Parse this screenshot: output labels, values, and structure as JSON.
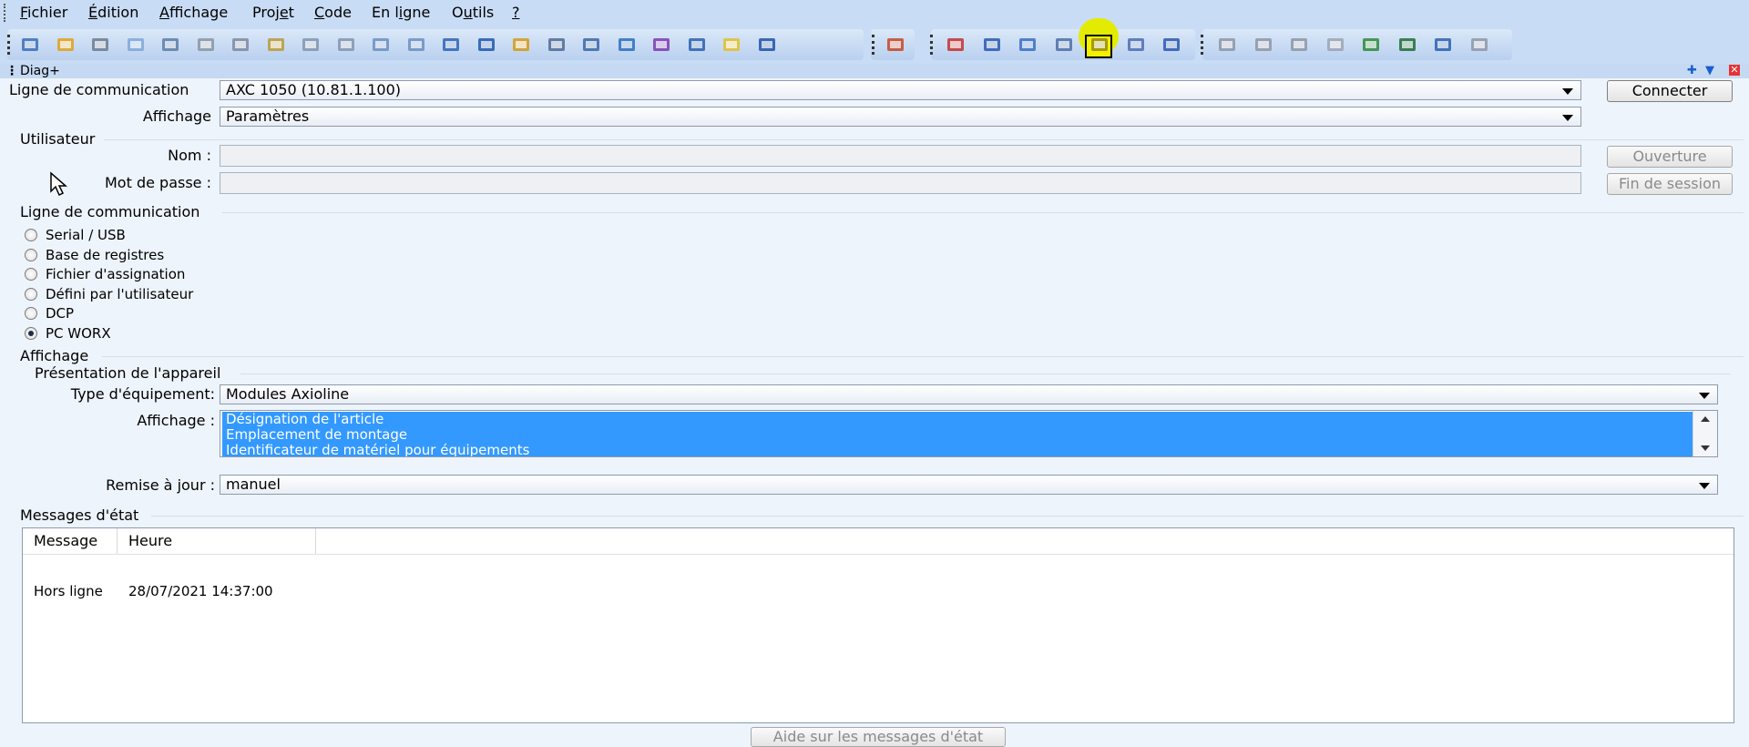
{
  "menu": {
    "fichier": {
      "acc": "F",
      "rest": "ichier"
    },
    "edition": {
      "acc": "É",
      "rest": "dition"
    },
    "affichage": {
      "acc": "A",
      "rest": "ffichage"
    },
    "projet": {
      "pre": "Proj",
      "acc": "e",
      "rest": "t"
    },
    "code": {
      "acc": "C",
      "rest": "ode"
    },
    "en_ligne": {
      "pre": "En l",
      "acc": "i",
      "rest": "gne"
    },
    "outils": {
      "pre": "O",
      "acc": "u",
      "rest": "tils"
    },
    "aide": {
      "acc": "?"
    }
  },
  "toolbar": {
    "highlight_color": "#e3ec00",
    "icons": [
      "new-file",
      "open-folder",
      "save",
      "search-preview",
      "print",
      "cut",
      "copy",
      "paste",
      "undo",
      "redo",
      "zoom-in",
      "zoom-out",
      "window-a",
      "window-b",
      "wand",
      "window-c",
      "window-d",
      "wave",
      "cross",
      "window-e",
      "note",
      "list",
      "tool",
      "panel-1",
      "panel-2",
      "panel-3",
      "panel-4",
      "diag-plus-active",
      "blank-window",
      "panel-5",
      "stack",
      "grid-1",
      "grid-2",
      "grid-3",
      "refresh",
      "module",
      "arrow-flag",
      "tool-cross"
    ]
  },
  "panel": {
    "title": "Diag+"
  },
  "communication": {
    "label": "Ligne de communication",
    "value": "AXC 1050 (10.81.1.100)",
    "connect_button": "Connecter"
  },
  "display": {
    "label": "Affichage",
    "value": "Paramètres"
  },
  "user": {
    "group_label": "Utilisateur",
    "name_label": "Nom :",
    "password_label": "Mot de passe :",
    "name_value": "",
    "password_value": "",
    "login_button": "Ouverture",
    "logout_button": "Fin de session"
  },
  "comm_line": {
    "group_label": "Ligne de communication",
    "options": [
      "Serial / USB",
      "Base de registres",
      "Fichier d'assignation",
      "Défini par l'utilisateur",
      "DCP",
      "PC WORX"
    ],
    "selected": "PC WORX"
  },
  "affichage_group": {
    "group_label": "Affichage",
    "presentation_label": "Présentation de l'appareil",
    "type_label": "Type d'équipement:",
    "type_value": "Modules Axioline",
    "display_label": "Affichage :",
    "display_items": [
      "Désignation de l'article",
      "Emplacement de montage",
      "Identificateur de matériel pour équipements"
    ],
    "refresh_label": "Remise à jour :",
    "refresh_value": "manuel"
  },
  "messages": {
    "group_label": "Messages d'état",
    "columns": [
      "Message",
      "Heure"
    ],
    "rows": [
      {
        "message": "Hors ligne",
        "time": "28/07/2021 14:37:00"
      }
    ],
    "help_button": "Aide sur les messages d'état"
  }
}
